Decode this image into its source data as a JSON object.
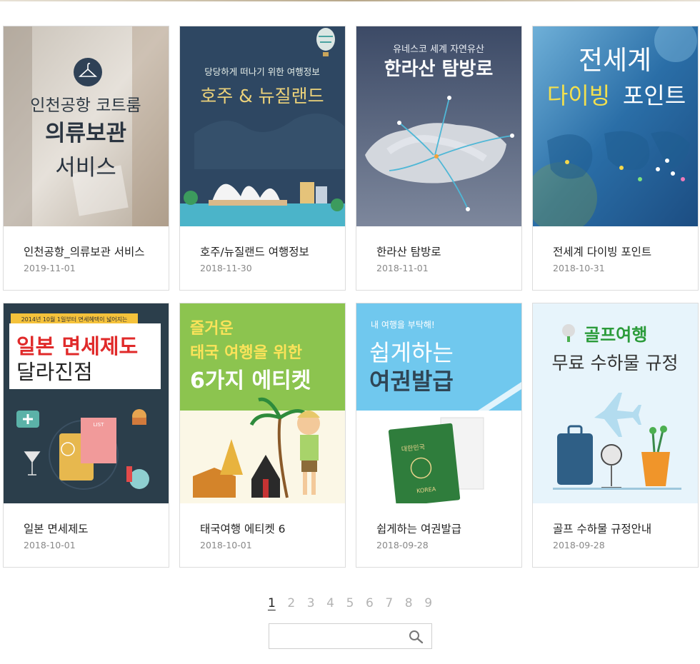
{
  "cards": [
    {
      "title": "인천공항_의류보관 서비스",
      "date": "2019-11-01",
      "thumb": {
        "lines": [
          "인천공항 코트룸",
          "의류보관",
          "서비스"
        ],
        "icon": "hanger-icon"
      }
    },
    {
      "title": "호주/뉴질랜드 여행정보",
      "date": "2018-11-30",
      "thumb": {
        "lines": [
          "당당하게 떠나기 위한 여행정보",
          "호주 & 뉴질랜드"
        ],
        "icon": "balloon-icon"
      }
    },
    {
      "title": "한라산 탐방로",
      "date": "2018-11-01",
      "thumb": {
        "lines": [
          "유네스코 세계 자연유산",
          "한라산 탐방로"
        ],
        "icon": "trail-map"
      }
    },
    {
      "title": "전세계 다이빙 포인트",
      "date": "2018-10-31",
      "thumb": {
        "lines": [
          "전세계",
          "다이빙",
          "포인트"
        ],
        "icon": "world-map"
      }
    },
    {
      "title": "일본 면세제도",
      "date": "2018-10-01",
      "thumb": {
        "lines": [
          "2014년 10월 1일부터 면세혜택이 넓어지는",
          "일본 면세제도",
          "달라진점",
          "LIST"
        ],
        "icon": "passport-icon"
      }
    },
    {
      "title": "태국여행 에티켓 6",
      "date": "2018-10-01",
      "thumb": {
        "lines": [
          "즐거운",
          "태국 여행을 위한",
          "6가지 에티켓"
        ],
        "icon": "temple-icon"
      }
    },
    {
      "title": "쉽게하는 여권발급",
      "date": "2018-09-28",
      "thumb": {
        "lines": [
          "내 여행을 부탁해!",
          "쉽게하는",
          "여권발급",
          "대한민국",
          "KOREA"
        ],
        "icon": "passport-icon"
      }
    },
    {
      "title": "골프 수하물 규정안내",
      "date": "2018-09-28",
      "thumb": {
        "lines": [
          "골프여행",
          "무료 수하물 규정"
        ],
        "icon": "golf-icon"
      }
    }
  ],
  "pagination": {
    "pages": [
      "1",
      "2",
      "3",
      "4",
      "5",
      "6",
      "7",
      "8",
      "9"
    ],
    "current": "1"
  },
  "search": {
    "value": "",
    "placeholder": ""
  },
  "colors": {
    "accent": "#b8a88a",
    "border": "#dcdcdc",
    "date": "#888888",
    "page_inactive": "#b3b3b3"
  }
}
